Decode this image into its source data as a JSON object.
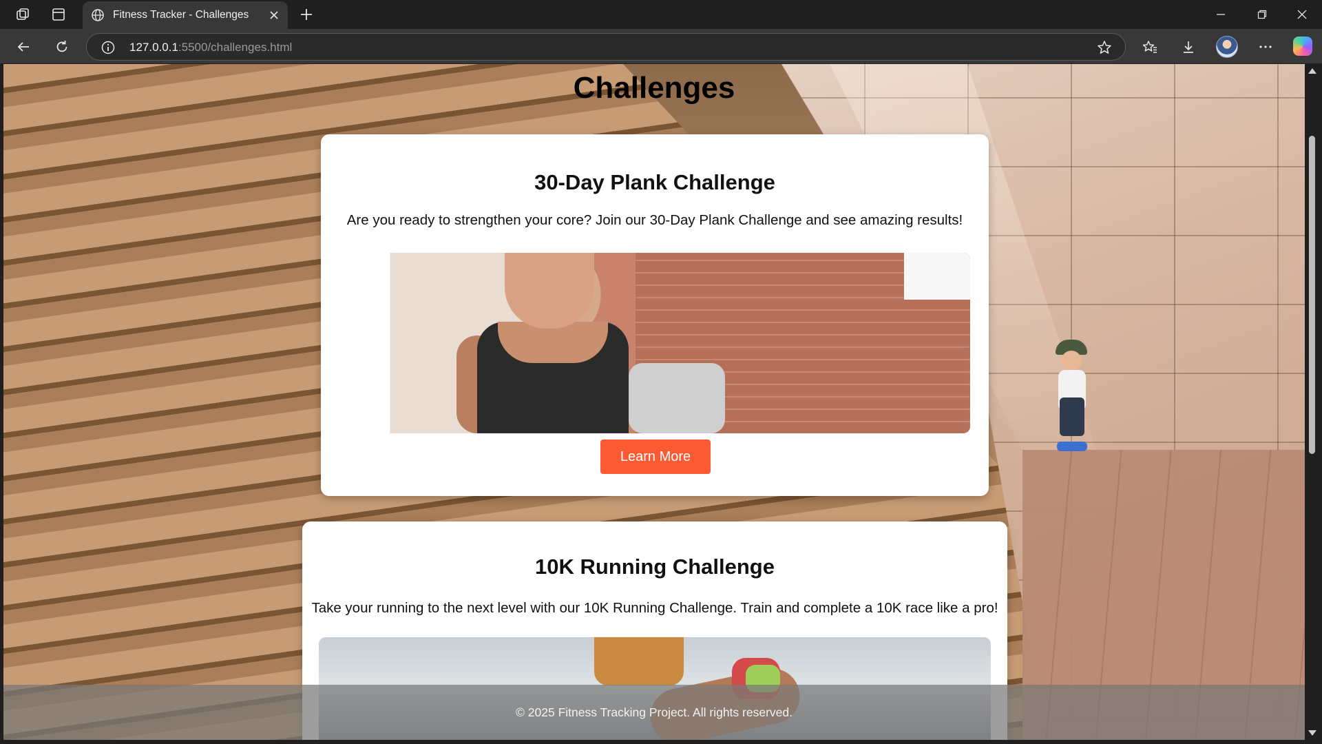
{
  "browser": {
    "tab_title": "Fitness Tracker - Challenges",
    "url_host": "127.0.0.1",
    "url_rest": ":5500/challenges.html"
  },
  "page": {
    "title": "Challenges",
    "challenges": [
      {
        "title": "30-Day Plank Challenge",
        "description": "Are you ready to strengthen your core? Join our 30-Day Plank Challenge and see amazing results!",
        "button_label": "Learn More"
      },
      {
        "title": "10K Running Challenge",
        "description": "Take your running to the next level with our 10K Running Challenge. Train and complete a 10K race like a pro!"
      }
    ],
    "footer": "© 2025 Fitness Tracking Project. All rights reserved."
  },
  "colors": {
    "accent_button": "#fc5a32",
    "card_background": "#ffffff",
    "chrome_dark": "#1f1f1f",
    "chrome_toolbar": "#383838"
  },
  "icons": [
    "workspaces-icon",
    "tab-actions-icon",
    "globe-icon",
    "close-icon",
    "new-tab-icon",
    "minimize-icon",
    "restore-icon",
    "window-close-icon",
    "back-icon",
    "refresh-icon",
    "site-info-icon",
    "favorite-star-icon",
    "favorites-icon",
    "downloads-icon",
    "profile-avatar",
    "more-icon",
    "copilot-icon"
  ]
}
